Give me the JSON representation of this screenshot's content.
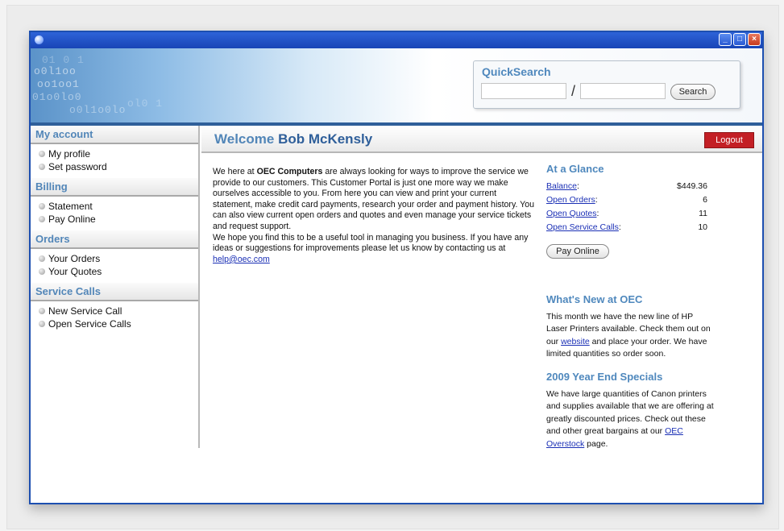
{
  "search": {
    "title": "QuickSearch",
    "slash": "/",
    "button_label": "Search"
  },
  "sidebar": {
    "sections": [
      {
        "heading": "My account",
        "items": [
          "My profile",
          "Set password"
        ]
      },
      {
        "heading": "Billing",
        "items": [
          "Statement",
          "Pay Online"
        ]
      },
      {
        "heading": "Orders",
        "items": [
          "Your Orders",
          "Your Quotes"
        ]
      },
      {
        "heading": "Service Calls",
        "items": [
          "New Service Call",
          "Open Service Calls"
        ]
      }
    ]
  },
  "main": {
    "welcome_prefix": "Welcome",
    "user_name": "Bob McKensly",
    "logout_label": "Logout",
    "intro": {
      "p1_before": "We here at ",
      "p1_bold": "OEC Computers",
      "p1_after": " are always looking for ways to improve the service we provide to our customers. This Customer Portal is just one more way we make ourselves accessible to you. From here you can view and print your current statement, make credit card payments, research your order and payment history. You can also view current open orders and quotes and even manage your service tickets and request support.",
      "p2_before": "We hope you find this to be a useful tool in managing you business. If you have any ideas or suggestions for improvements please let us know by contacting us at ",
      "email": "help@oec.com"
    }
  },
  "glance": {
    "title": "At a Glance",
    "rows": [
      {
        "label": "Balance",
        "value": "$449.36"
      },
      {
        "label": "Open Orders",
        "value": "6"
      },
      {
        "label": "Open Quotes",
        "value": "11"
      },
      {
        "label": "Open Service Calls",
        "value": "10"
      }
    ],
    "pay_button": "Pay Online"
  },
  "whats_new": {
    "title": "What's New at OEC",
    "text_before": "This month we have the new line of HP Laser Printers available. Check them out on our ",
    "link": "website",
    "text_after": " and place your order. We have limited quantities so order soon."
  },
  "specials": {
    "title": "2009 Year End Specials",
    "text_before": "We have large quantities of Canon printers and supplies available that we are offering at greatly discounted prices. Check out these and other great bargains at our ",
    "link": "OEC Overstock",
    "text_after": " page."
  },
  "colors": {
    "accent": "#4f88bd",
    "logout": "#c31f25",
    "window_border": "#1d4fb0"
  }
}
